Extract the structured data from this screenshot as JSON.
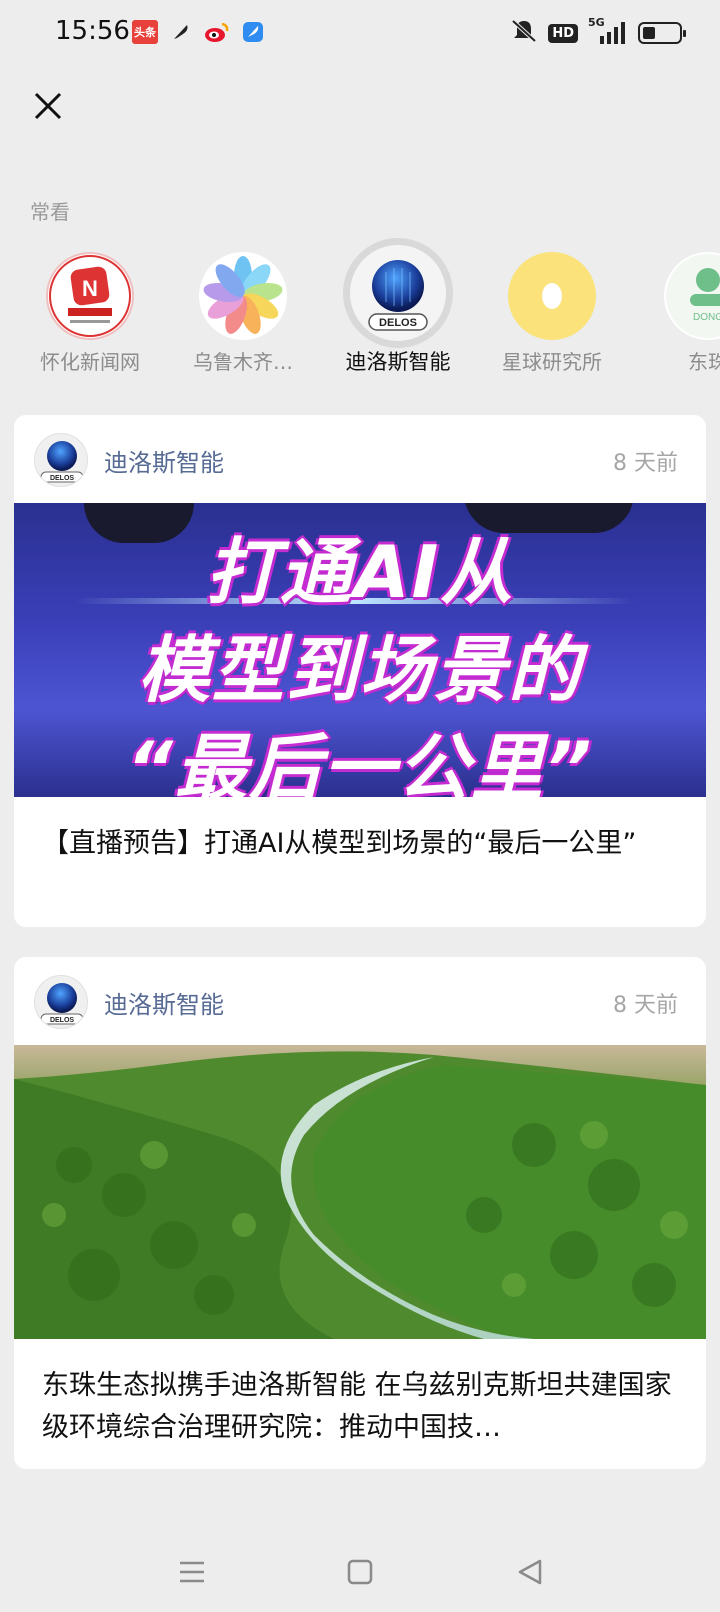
{
  "status_bar": {
    "time": "15:56",
    "notification_icons": [
      "toutiao-icon",
      "feather-icon",
      "weibo-icon",
      "feather-blue-icon"
    ],
    "toutiao_label": "头条",
    "hd_label": "HD",
    "network_label": "5G",
    "battery_level": 0.35
  },
  "close_icon": "close-icon",
  "frequent": {
    "label": "常看",
    "accounts": [
      {
        "name": "怀化新闻网",
        "avatar": "huaihua-logo"
      },
      {
        "name": "乌鲁木齐…",
        "avatar": "petal-logo"
      },
      {
        "name": "迪洛斯智能",
        "avatar": "delos-logo",
        "selected": true
      },
      {
        "name": "星球研究所",
        "avatar": "yellow-ring-logo"
      },
      {
        "name": "东珠",
        "avatar": "dongzhu-logo"
      }
    ],
    "delos_logo_text": "DELOS"
  },
  "articles": [
    {
      "author": "迪洛斯智能",
      "time": "8 天前",
      "banner_lines": [
        "打通AI从",
        "模型到场景的",
        "“最后一公里”"
      ],
      "title": "【直播预告】打通AI从模型到场景的“最后一公里”"
    },
    {
      "author": "迪洛斯智能",
      "time": "8 天前",
      "image": "forest-river-photo",
      "title": "东珠生态拟携手迪洛斯智能 在乌兹别克斯坦共建国家级环境综合治理研究院：推动中国技…"
    }
  ],
  "nav": {
    "menu_icon": "menu-icon",
    "home_icon": "home-square-icon",
    "back_icon": "back-triangle-icon"
  }
}
